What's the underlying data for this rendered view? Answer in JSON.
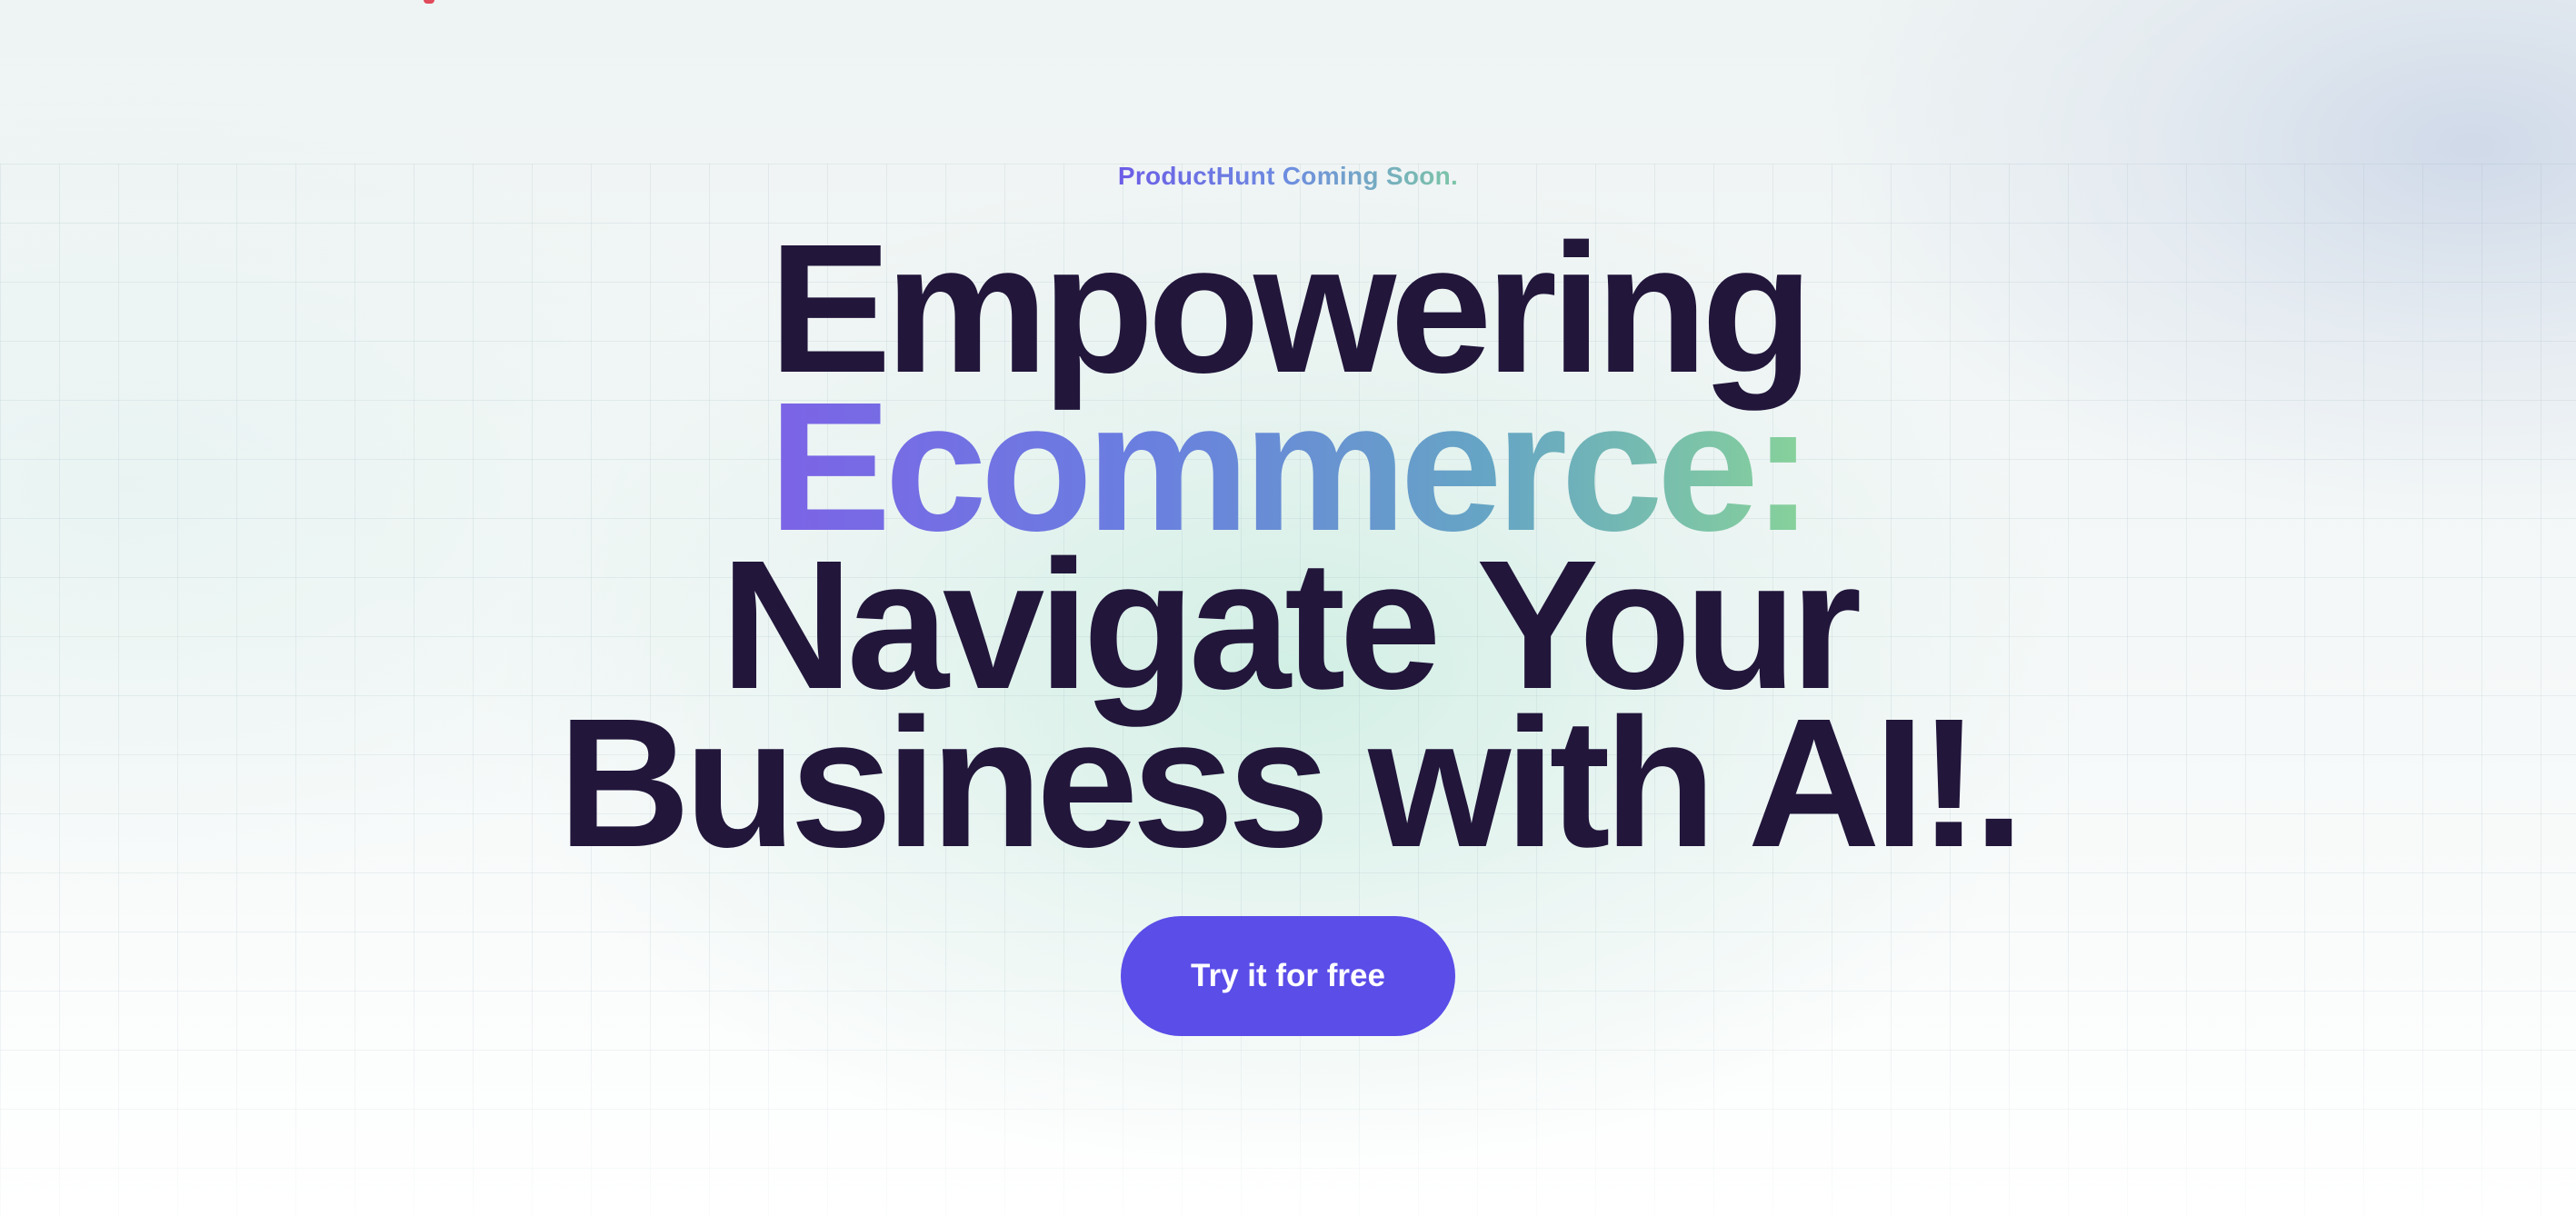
{
  "hero": {
    "eyebrow": "ProductHunt Coming Soon.",
    "headline": {
      "line1": "Empowering",
      "line2_accent": "Ecommerce:",
      "line3": "Navigate Your",
      "line4": "Business with AI!."
    },
    "cta_label": "Try it for free"
  },
  "colors": {
    "headline": "#22163b",
    "cta_background": "#5a4de8",
    "accent_gradient_start": "#7c63e6",
    "accent_gradient_end": "#87d29a"
  }
}
